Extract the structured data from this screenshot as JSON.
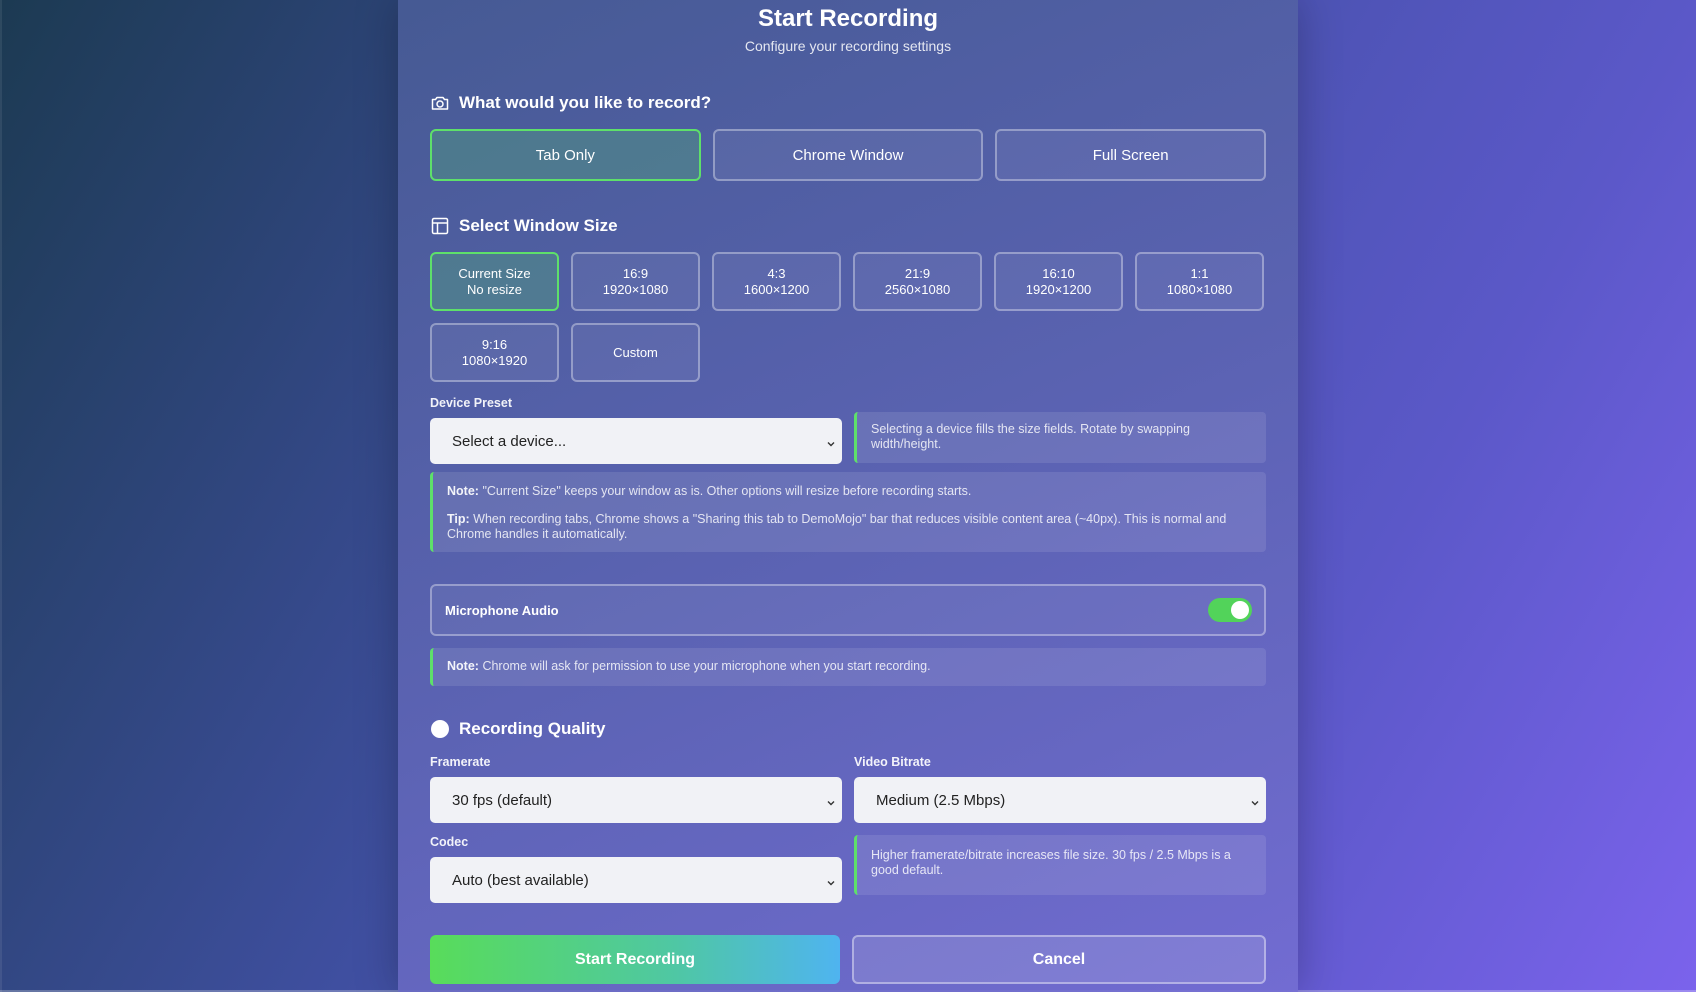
{
  "header": {
    "title": "Start Recording",
    "subtitle": "Configure your recording settings"
  },
  "record_mode": {
    "title": "What would you like to record?",
    "icon": "camera-icon",
    "options": [
      {
        "label": "Tab Only",
        "active": true
      },
      {
        "label": "Chrome Window",
        "active": false
      },
      {
        "label": "Full Screen",
        "active": false
      }
    ]
  },
  "window_size": {
    "title": "Select Window Size",
    "icon": "layout-icon",
    "options": [
      {
        "line1": "Current Size",
        "line2": "No resize",
        "active": true
      },
      {
        "line1": "16:9",
        "line2": "1920×1080",
        "active": false
      },
      {
        "line1": "4:3",
        "line2": "1600×1200",
        "active": false
      },
      {
        "line1": "21:9",
        "line2": "2560×1080",
        "active": false
      },
      {
        "line1": "16:10",
        "line2": "1920×1200",
        "active": false
      },
      {
        "line1": "1:1",
        "line2": "1080×1080",
        "active": false
      },
      {
        "line1": "9:16",
        "line2": "1080×1920",
        "active": false
      },
      {
        "line1": "Custom",
        "line2": "",
        "active": false
      }
    ]
  },
  "device_preset": {
    "label": "Device Preset",
    "value": "Select a device...",
    "hint": "Selecting a device fills the size fields. Rotate by swapping width/height."
  },
  "size_note": {
    "note_label": "Note:",
    "note_text": "\"Current Size\" keeps your window as is. Other options will resize before recording starts.",
    "tip_label": "Tip:",
    "tip_text": "When recording tabs, Chrome shows a \"Sharing this tab to DemoMojo\" bar that reduces visible content area (~40px). This is normal and Chrome handles it automatically."
  },
  "microphone": {
    "label": "Microphone Audio",
    "enabled": true,
    "note_label": "Note:",
    "note_text": "Chrome will ask for permission to use your microphone when you start recording."
  },
  "quality": {
    "title": "Recording Quality",
    "icon": "circle-icon",
    "framerate_label": "Framerate",
    "framerate_value": "30 fps (default)",
    "bitrate_label": "Video Bitrate",
    "bitrate_value": "Medium (2.5 Mbps)",
    "codec_label": "Codec",
    "codec_value": "Auto (best available)",
    "hint": "Higher framerate/bitrate increases file size. 30 fps / 2.5 Mbps is a good default."
  },
  "actions": {
    "start_label": "Start Recording",
    "cancel_label": "Cancel"
  },
  "colors": {
    "accent_green": "#5ee06a",
    "toggle_on": "#52d35a"
  }
}
